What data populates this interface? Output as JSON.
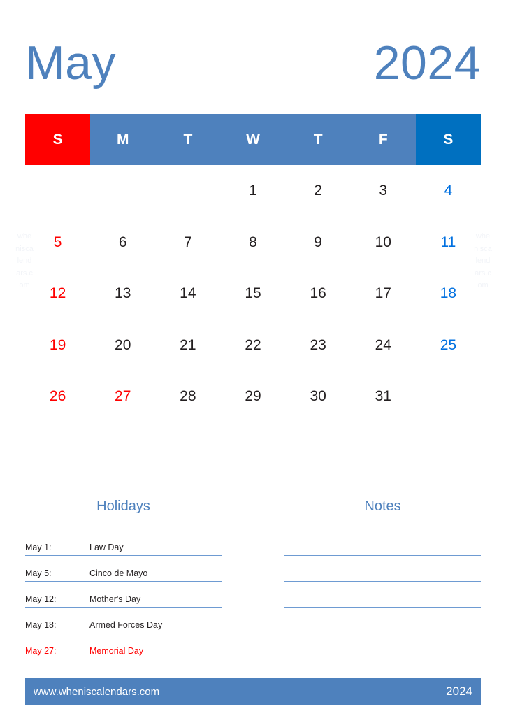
{
  "header": {
    "month": "May",
    "year": "2024"
  },
  "watermark": {
    "text": "wheniscalendars.com"
  },
  "calendar": {
    "weekday_headers": [
      {
        "label": "S",
        "kind": "sun"
      },
      {
        "label": "M",
        "kind": "weekday"
      },
      {
        "label": "T",
        "kind": "weekday"
      },
      {
        "label": "W",
        "kind": "weekday"
      },
      {
        "label": "T",
        "kind": "weekday"
      },
      {
        "label": "F",
        "kind": "weekday"
      },
      {
        "label": "S",
        "kind": "sat"
      }
    ],
    "weeks": [
      [
        "",
        "",
        "",
        "1",
        "2",
        "3",
        "4"
      ],
      [
        "5",
        "6",
        "7",
        "8",
        "9",
        "10",
        "11"
      ],
      [
        "12",
        "13",
        "14",
        "15",
        "16",
        "17",
        "18"
      ],
      [
        "19",
        "20",
        "21",
        "22",
        "23",
        "24",
        "25"
      ],
      [
        "26",
        "27",
        "28",
        "29",
        "30",
        "31",
        ""
      ]
    ],
    "holiday_dates": [
      "27"
    ]
  },
  "holidays": {
    "title": "Holidays",
    "items": [
      {
        "date": "May 1:",
        "name": "Law Day",
        "red": false
      },
      {
        "date": "May 5:",
        "name": "Cinco de Mayo",
        "red": false
      },
      {
        "date": "May 12:",
        "name": "Mother's Day",
        "red": false
      },
      {
        "date": "May 18:",
        "name": "Armed Forces Day",
        "red": false
      },
      {
        "date": "May 27:",
        "name": "Memorial Day",
        "red": true
      }
    ]
  },
  "notes": {
    "title": "Notes",
    "line_count": 5
  },
  "footer": {
    "website": "www.wheniscalendars.com",
    "year": "2024"
  },
  "colors": {
    "accent_blue": "#4e81bd",
    "saturday_blue": "#0070c0",
    "saturday_number_blue": "#0070e0",
    "sunday_red": "#ff0000",
    "day_text": "#231f20",
    "rule_blue": "#6e9bd2"
  }
}
